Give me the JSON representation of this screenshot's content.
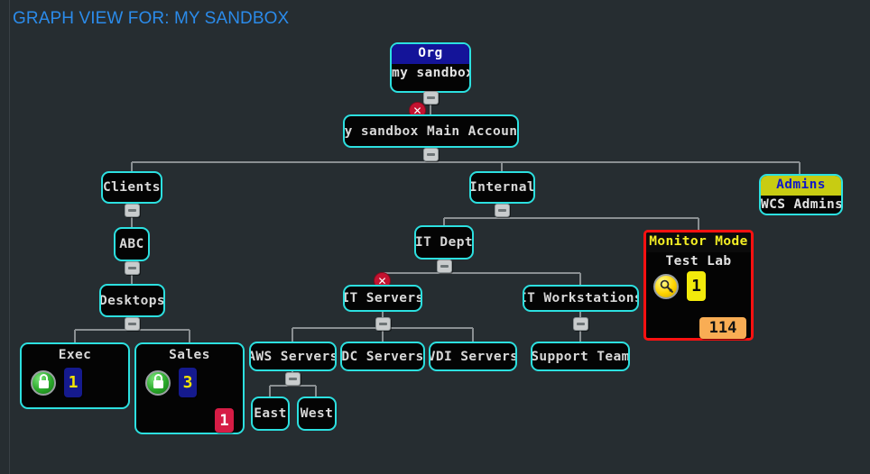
{
  "page": {
    "title": "GRAPH VIEW FOR: MY SANDBOX",
    "title_color": "#2b8bea",
    "background_color": "#262d31"
  },
  "graph": {
    "nodes": {
      "org": {
        "header": "Org",
        "body": "my sandbox",
        "header_bg": "#141499",
        "header_fg": "#ffffff",
        "border_color": "#2ce0e0"
      },
      "main_account": {
        "label": "my sandbox Main Account"
      },
      "clients": {
        "label": "Clients"
      },
      "internal": {
        "label": "Internal"
      },
      "admins": {
        "header": "Admins",
        "body": "WCS Admins",
        "header_bg": "#c8cc12",
        "header_fg": "#1018c8"
      },
      "abc": {
        "label": "ABC"
      },
      "it_dept": {
        "label": "IT Dept"
      },
      "monitor": {
        "header": "Monitor Mode",
        "body": "Test Lab",
        "header_fg": "#f5ef24",
        "border_color": "#ff1111",
        "key_badge": "1",
        "count_badge": "114"
      },
      "desktops": {
        "label": "Desktops"
      },
      "it_servers": {
        "label": "IT Servers"
      },
      "it_workstations": {
        "label": "IT Workstations"
      },
      "exec": {
        "label": "Exec",
        "lock_badge": "1"
      },
      "sales": {
        "label": "Sales",
        "lock_badge": "3",
        "alert_badge": "1"
      },
      "aws_servers": {
        "label": "AWS Servers"
      },
      "dc_servers": {
        "label": "DC Servers"
      },
      "vdi_servers": {
        "label": "VDI Servers"
      },
      "support_team": {
        "label": "Support Team"
      },
      "east": {
        "label": "East"
      },
      "west": {
        "label": "West"
      }
    },
    "toggle_glyph": "−",
    "error_glyph": "✕",
    "icons": {
      "lock": "padlock-icon",
      "key": "key-icon",
      "collapse": "collapse-minus-icon",
      "error": "error-cross-icon"
    }
  }
}
